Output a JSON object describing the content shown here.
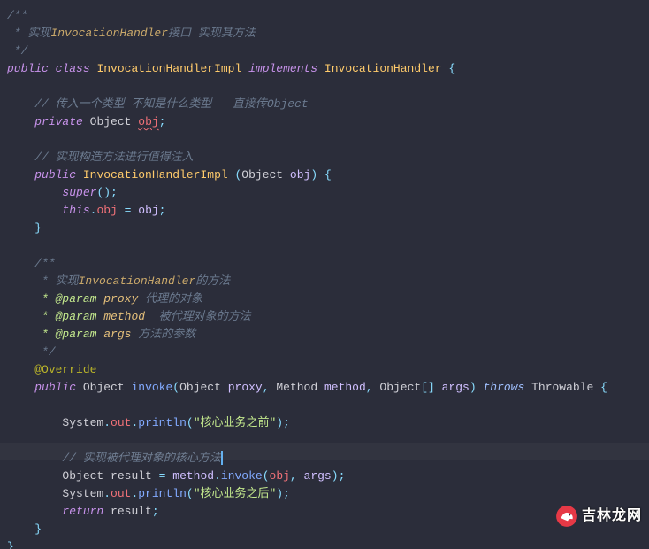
{
  "code": {
    "comment_class_1": "/**",
    "comment_class_2": " * 实现",
    "comment_class_2b": "InvocationHandler",
    "comment_class_2c": "接口 实现其方法",
    "comment_class_3": " */",
    "kw_public": "public",
    "kw_class": "class",
    "class_name": "InvocationHandlerImpl",
    "kw_implements": "implements",
    "iface_name": "InvocationHandler",
    "lbrace": "{",
    "rbrace": "}",
    "comment_field": "// 传入一个类型 不知是什么类型   直接传Object",
    "kw_private": "private",
    "type_object": "Object",
    "field_obj": "obj",
    "semicolon": ";",
    "comment_ctor": "// 实现构造方法进行值得注入",
    "ctor_name": "InvocationHandlerImpl",
    "param_obj": "obj",
    "lparen": "(",
    "rparen": ")",
    "kw_super": "super",
    "empty_args": "();",
    "kw_this": "this",
    "dot": ".",
    "assign": " = ",
    "doc_open": "/**",
    "doc_desc_a": " * 实现",
    "doc_desc_b": "InvocationHandler",
    "doc_desc_c": "的方法",
    "doc_param": " * @param",
    "doc_proxy_name": " proxy",
    "doc_proxy_desc": " 代理的对象",
    "doc_method_name": " method",
    "doc_method_desc": "  被代理对象的方法",
    "doc_args_name": " args",
    "doc_args_desc": " 方法的参数",
    "doc_close": " */",
    "anno_override": "@Override",
    "method_invoke": "invoke",
    "type_method": "Method",
    "param_proxy": "proxy",
    "param_method": "method",
    "param_args": "args",
    "array_suffix": "[]",
    "kw_throws": "throws",
    "type_throwable": "Throwable",
    "field_system": "System",
    "field_out": "out",
    "method_println": "println",
    "str_before": "\"核心业务之前\"",
    "str_after": "\"核心业务之后\"",
    "comment_core": "// 实现被代理对象的核心方法",
    "var_result": "result",
    "method_method_invoke": "invoke",
    "comma": ", ",
    "kw_return": "return"
  },
  "watermark": {
    "text": "吉林龙网"
  }
}
